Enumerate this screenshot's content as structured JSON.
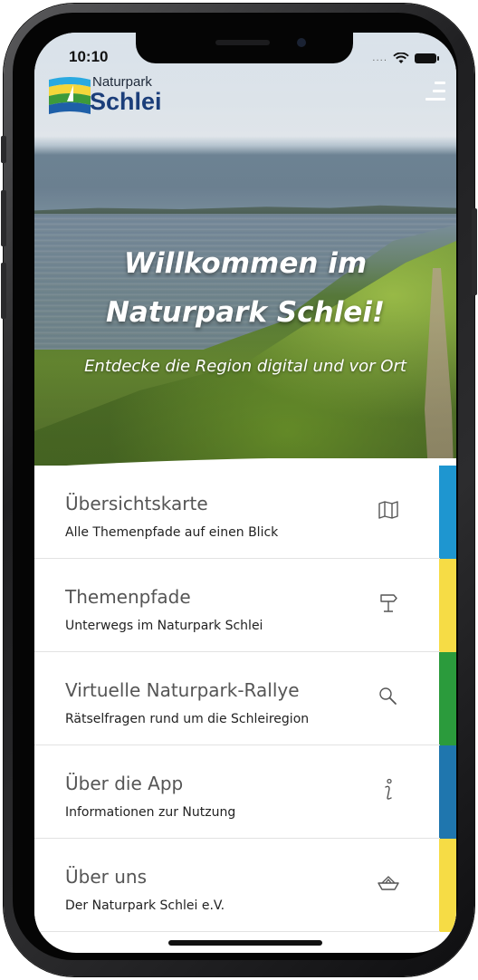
{
  "status_bar": {
    "time": "10:10"
  },
  "header": {
    "logo_small": "Naturpark",
    "logo_big": "Schlei"
  },
  "hero": {
    "title_line1": "Willkommen im",
    "title_line2": "Naturpark Schlei!",
    "subtitle": "Entdecke die Region digital und vor Ort"
  },
  "menu": {
    "items": [
      {
        "title": "Übersichtskarte",
        "subtitle": "Alle Themenpfade auf einen Blick",
        "icon": "map-icon",
        "color": "#1e96d0"
      },
      {
        "title": "Themenpfade",
        "subtitle": "Unterwegs im Naturpark Schlei",
        "icon": "signpost-icon",
        "color": "#f6dc45"
      },
      {
        "title": "Virtuelle Naturpark-Rallye",
        "subtitle": "Rätselfragen rund um die Schleiregion",
        "icon": "magnifier-icon",
        "color": "#2b9b3c"
      },
      {
        "title": "Über die App",
        "subtitle": "Informationen zur Nutzung",
        "icon": "info-icon",
        "color": "#1f76ae"
      },
      {
        "title": "Über uns",
        "subtitle": "Der Naturpark Schlei e.V.",
        "icon": "paper-boat-icon",
        "color": "#f6dc45"
      }
    ]
  }
}
